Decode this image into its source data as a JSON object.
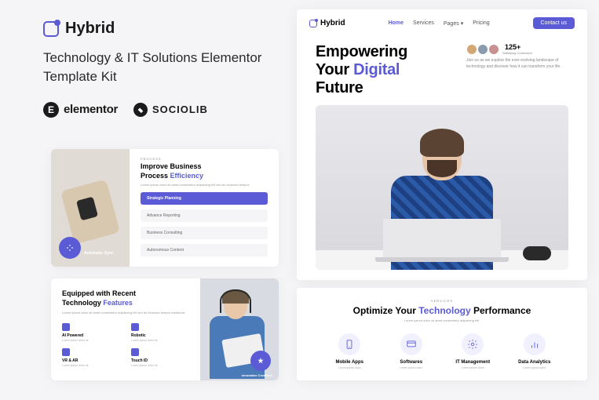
{
  "product": {
    "name": "Hybrid",
    "tagline": "Technology & IT Solutions Elementor Template Kit"
  },
  "brands": {
    "elementor": "elementor",
    "sociolib": "SOCIOLIB"
  },
  "preview": {
    "logo": "Hybrid",
    "nav": [
      "Home",
      "Services",
      "Pages",
      "Pricing"
    ],
    "cta": "Contact us",
    "hero_title_1": "Empowering",
    "hero_title_2a": "Your ",
    "hero_title_2b": "Digital",
    "hero_title_3": "Future",
    "customers_count": "125+",
    "customers_label": "Satisfying Customers",
    "hero_desc": "Join us as we explore the ever-evolving landscape of technology and discover how it can transform your life."
  },
  "process": {
    "eyebrow": "PROCESS",
    "title_1": "Improve Business",
    "title_2a": "Process ",
    "title_2b": "Efficiency",
    "desc": "Lorem ipsum dolor sit amet consectetur adipiscing elit sed do eiusmod tempor.",
    "items": [
      "Strategic Planning",
      "Advance Reporting",
      "Business Consulting",
      "Autonomous Content"
    ],
    "badge": "Automatic Sync"
  },
  "features": {
    "title_1": "Equipped with Recent",
    "title_2a": "Technology ",
    "title_2b": "Features",
    "desc": "Lorem ipsum dolor sit amet consectetur adipiscing elit sed do eiusmod tempor incididunt.",
    "items": [
      {
        "name": "AI Powered",
        "desc": "Lorem ipsum dolor sit"
      },
      {
        "name": "Robotic",
        "desc": "Lorem ipsum dolor sit"
      },
      {
        "name": "VR & AR",
        "desc": "Lorem ipsum dolor sit"
      },
      {
        "name": "Touch ID",
        "desc": "Lorem ipsum dolor sit"
      }
    ],
    "badge": "Innovative Creations"
  },
  "services": {
    "eyebrow": "SERVICES",
    "title_1": "Optimize Your ",
    "title_accent": "Technology",
    "title_2": " Performance",
    "desc": "Lorem ipsum dolor sit amet consectetur adipiscing elit.",
    "items": [
      {
        "name": "Mobile Apps",
        "desc": "Lorem ipsum dolor"
      },
      {
        "name": "Softwares",
        "desc": "Lorem ipsum dolor"
      },
      {
        "name": "IT Management",
        "desc": "Lorem ipsum dolor"
      },
      {
        "name": "Data Analytics",
        "desc": "Lorem ipsum dolor"
      }
    ]
  }
}
